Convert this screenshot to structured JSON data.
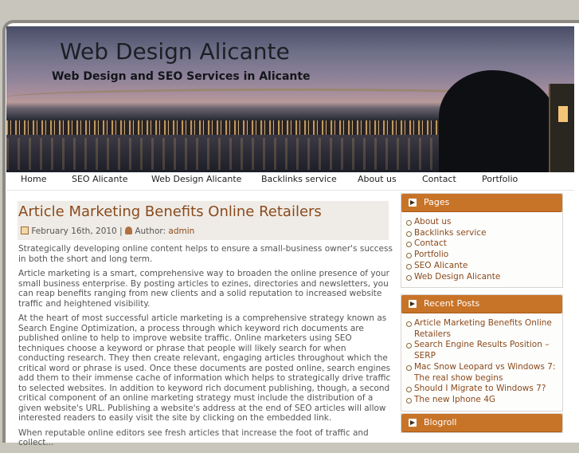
{
  "header": {
    "title": "Web Design Alicante",
    "tagline": "Web Design and SEO Services in Alicante"
  },
  "nav": {
    "items": [
      "Home",
      "SEO Alicante",
      "Web Design Alicante",
      "Backlinks service",
      "About us",
      "Contact",
      "Portfolio"
    ]
  },
  "post": {
    "title": "Article Marketing Benefits Online Retailers",
    "date": "February 16th, 2010",
    "separator": "|",
    "author_label": "Author:",
    "author": "admin",
    "paragraphs": [
      "Strategically developing online content helps to ensure a small-business owner's success in both the short and long term.",
      "Article marketing is a smart, comprehensive way to broaden the online presence of your small business enterprise. By posting articles to ezines, directories and newsletters, you can reap benefits ranging from new clients and a solid reputation to increased website traffic and heightened visibility.",
      "At the heart of most successful article marketing is a comprehensive strategy known as Search Engine Optimization, a process through which keyword rich documents are published online to help to improve website traffic. Online marketers using SEO techniques choose a keyword or phrase that people will likely search for when conducting research. They then create relevant, engaging articles throughout which the critical word or phrase is used. Once these documents are posted online, search engines add them to their immense cache of information which helps to strategically drive traffic to selected websites. In addition to keyword rich document publishing, though, a second critical component of an online marketing strategy must include the distribution of a given website's URL. Publishing a website's address at the end of SEO articles will allow interested readers to easily visit the site by clicking on the embedded link.",
      "When reputable online editors see fresh articles that increase the foot of traffic and collect..."
    ]
  },
  "sidebar": {
    "pages": {
      "title": "Pages",
      "items": [
        "About us",
        "Backlinks service",
        "Contact",
        "Portfolio",
        "SEO Alicante",
        "Web Design Alicante"
      ]
    },
    "recent": {
      "title": "Recent Posts",
      "items": [
        "Article Marketing Benefits Online Retailers",
        "Search Engine Results Position – SERP",
        "Mac Snow Leopard vs Windows 7: The real show begins",
        "Should I Migrate to Windows 7?",
        "The new Iphone 4G"
      ]
    },
    "blogroll": {
      "title": "Blogroll"
    }
  }
}
